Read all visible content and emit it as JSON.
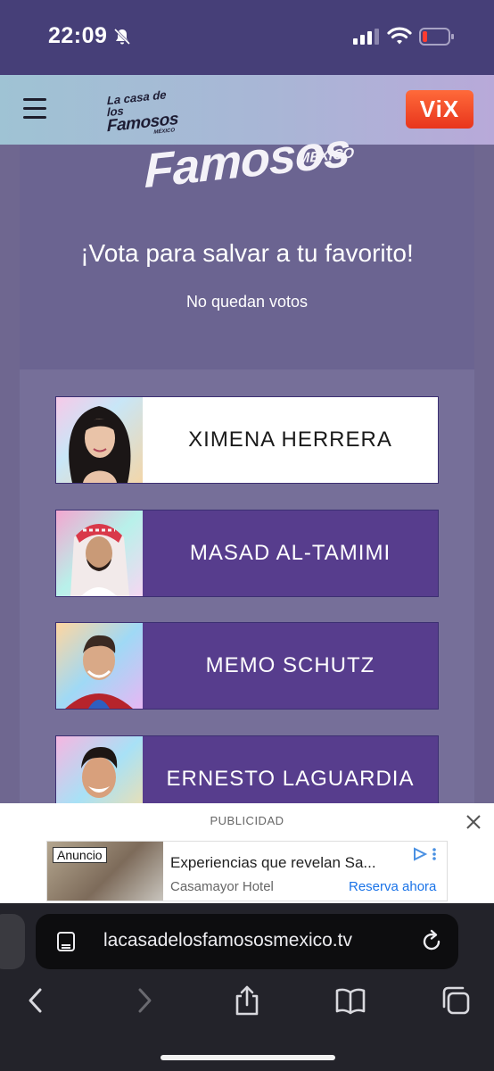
{
  "status_bar": {
    "time": "22:09"
  },
  "header": {
    "logo": {
      "line1": "La casa de los",
      "line2": "Famosos",
      "line3": "MÉXICO"
    },
    "vix_label": "ViX"
  },
  "main": {
    "brand_big": "Famosos",
    "brand_small": "MÉXICO",
    "vote_title": "¡Vota para salvar a tu favorito!",
    "vote_subtitle": "No quedan votos",
    "candidates": [
      {
        "name": "XIMENA HERRERA",
        "selected": true
      },
      {
        "name": "MASAD AL-TAMIMI",
        "selected": false
      },
      {
        "name": "MEMO SCHUTZ",
        "selected": false
      },
      {
        "name": "ERNESTO LAGUARDIA",
        "selected": false
      }
    ]
  },
  "ad": {
    "label": "PUBLICIDAD",
    "badge": "Anuncio",
    "title": "Experiencias que revelan Sa...",
    "advertiser": "Casamayor Hotel",
    "cta": "Reserva ahora"
  },
  "browser": {
    "url": "lacasadelosfamososmexico.tv"
  }
}
